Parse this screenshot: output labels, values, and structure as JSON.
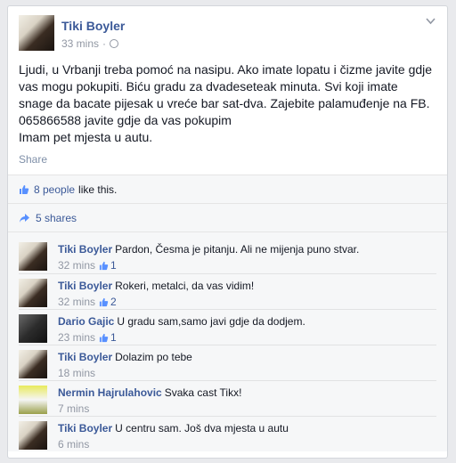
{
  "post": {
    "author": "Tiki Boyler",
    "time": "33 mins",
    "lines": [
      "Ljudi, u Vrbanji treba pomoć na nasipu. Ako imate lopatu i čizme javite gdje",
      "vas mogu pokupiti. Biću gradu za dvadeseteak minuta. Svi koji imate",
      "snage da bacate pijesak u vreće bar sat-dva. Zajebite palamuđenje na FB.",
      "065866588 javite gdje da vas pokupim",
      "Imam pet mjesta u autu."
    ],
    "share_label": "Share"
  },
  "feedback": {
    "likes_link": "8 people",
    "likes_text": "like this.",
    "shares_label": "5 shares"
  },
  "comments": [
    {
      "author": "Tiki Boyler",
      "text": "Pardon, Česma je pitanju. Ali ne mijenja puno stvar.",
      "time": "32 mins",
      "likes": "1"
    },
    {
      "author": "Tiki Boyler",
      "text": "Rokeri, metalci, da vas vidim!",
      "time": "32 mins",
      "likes": "2"
    },
    {
      "author": "Dario Gajic",
      "text": "U gradu sam,samo javi gdje da dodjem.",
      "time": "23 mins",
      "likes": "1"
    },
    {
      "author": "Tiki Boyler",
      "text": "Dolazim po tebe",
      "time": "18 mins"
    },
    {
      "author": "Nermin Hajrulahovic",
      "text": "Svaka cast Tikx!",
      "time": "7 mins"
    },
    {
      "author": "Tiki Boyler",
      "text": "U centru sam. Još dva mjesta u autu",
      "time": "6 mins"
    }
  ],
  "colors": {
    "link": "#3b5998",
    "meta": "#9197a3",
    "background": "#e9eaed"
  },
  "icons": [
    "globe-icon",
    "chevron-down-icon",
    "thumbs-up-icon",
    "share-arrow-icon"
  ]
}
